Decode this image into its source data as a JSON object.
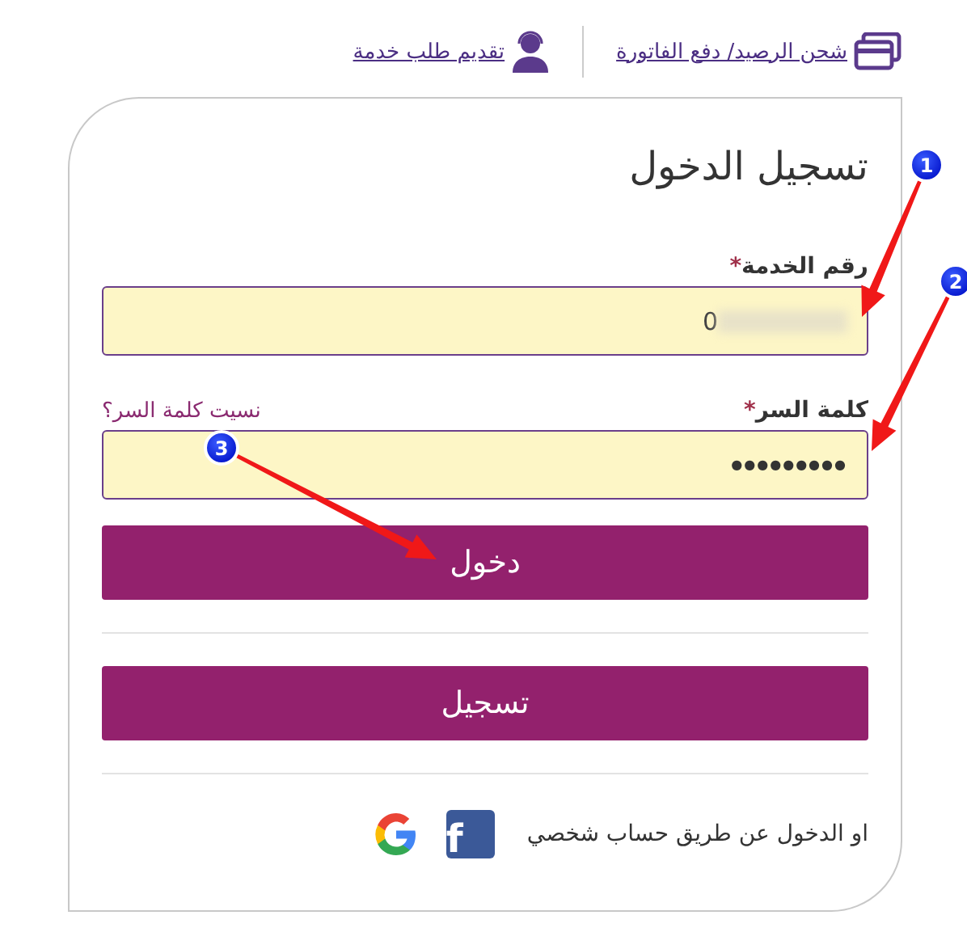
{
  "top_links": [
    {
      "kind": "card",
      "label": "شحن الرصيد/ دفع الفاتورة"
    },
    {
      "kind": "agent",
      "label": "تقديم طلب خدمة"
    }
  ],
  "login": {
    "title": "تسجيل الدخول",
    "fields": [
      {
        "label": "رقم الخدمة",
        "required_mark": "*",
        "value": "0",
        "masked": false,
        "redacted": true
      },
      {
        "label": "كلمة السر",
        "required_mark": "*",
        "value": "●●●●●●●●●",
        "masked": true,
        "link": "نسيت كلمة السر؟"
      }
    ],
    "buttons": [
      "دخول",
      "تسجيل"
    ],
    "social_text": "او الدخول عن طريق حساب شخصي",
    "social": [
      {
        "kind": "facebook",
        "label": "f"
      },
      {
        "kind": "google"
      }
    ]
  },
  "annotations": [
    {
      "number": "1"
    },
    {
      "number": "2"
    },
    {
      "number": "3"
    }
  ]
}
